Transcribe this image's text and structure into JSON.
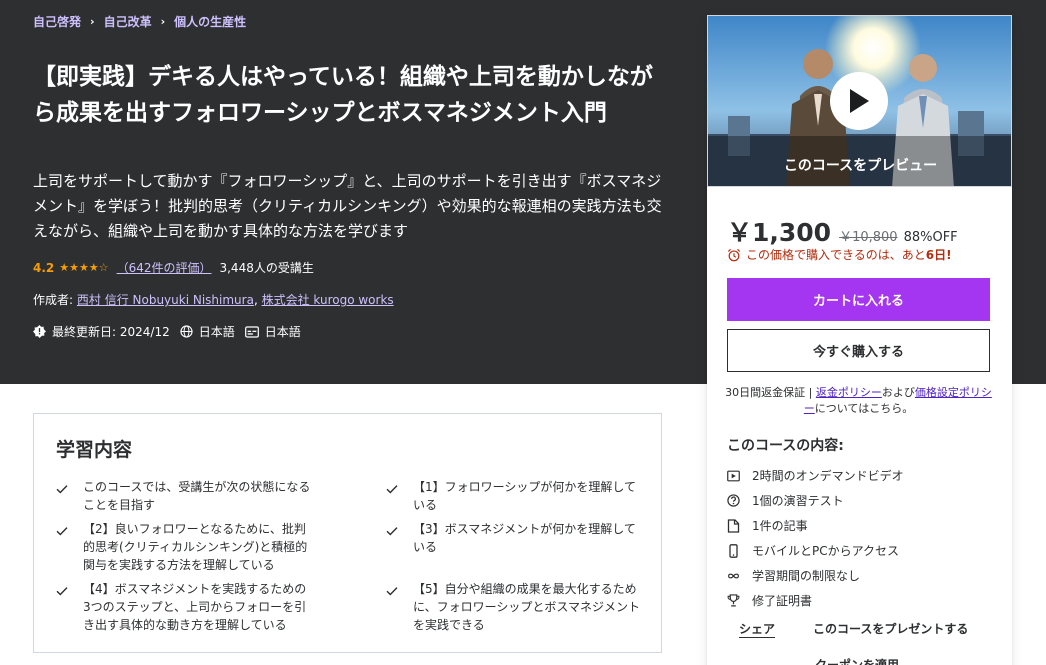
{
  "breadcrumb": [
    "自己啓発",
    "自己改革",
    "個人の生産性"
  ],
  "course": {
    "title": "【即実践】デキる人はやっている！組織や上司を動かしながら成果を出すフォロワーシップとボスマネジメント入門",
    "subtitle": "上司をサポートして動かす『フォロワーシップ』と、上司のサポートを引き出す『ボスマネジメント』を学ぼう！批判的思考（クリティカルシンキング）や効果的な報連相の実践方法も交えながら、組織や上司を動かす具体的な方法を学びます",
    "rating": "4.2",
    "rating_count": "（642件の評価）",
    "students": "3,448人の受講生",
    "authors_label": "作成者:",
    "author1": "西村 信行 Nobuyuki Nishimura",
    "author2": "株式会社 kurogo works",
    "updated": "最終更新日: 2024/12",
    "language": "日本語",
    "captions": "日本語"
  },
  "card": {
    "preview_label": "このコースをプレビュー",
    "price": "￥1,300",
    "original_price": "￥10,800",
    "discount": "88%OFF",
    "urgency_text": "この価格で購入できるのは、あと",
    "urgency_days": "6日!",
    "cart_button": "カートに入れる",
    "buy_button": "今すぐ購入する",
    "guarantee_prefix": "30日間返金保証 |",
    "refund_link": "返金ポリシー",
    "and_text": "および",
    "pricing_link": "価格設定ポリシー",
    "suffix": "についてはこちら。",
    "includes_title": "このコースの内容:",
    "includes": [
      {
        "icon": "video-icon",
        "label": "2時間のオンデマンドビデオ"
      },
      {
        "icon": "quiz-icon",
        "label": "1個の演習テスト"
      },
      {
        "icon": "file-icon",
        "label": "1件の記事"
      },
      {
        "icon": "mobile-icon",
        "label": "モバイルとPCからアクセス"
      },
      {
        "icon": "infinity-icon",
        "label": "学習期間の制限なし"
      },
      {
        "icon": "trophy-icon",
        "label": "修了証明書"
      }
    ],
    "share": "シェア",
    "gift": "このコースをプレゼントする",
    "coupon": "クーポンを適用"
  },
  "learn": {
    "title": "学習内容",
    "items": [
      "このコースでは、受講生が次の状態になることを目指す",
      "【1】フォロワーシップが何かを理解している",
      "【2】良いフォロワーとなるために、批判的思考(クリティカルシンキング)と積極的関与を実践する方法を理解している",
      "【3】ボスマネジメントが何かを理解している",
      "【4】ボスマネジメントを実践するための3つのステップと、上司からフォローを引き出す具体的な動き方を理解している",
      "【5】自分や組織の成果を最大化するために、フォロワーシップとボスマネジメントを実践できる"
    ]
  },
  "colors": {
    "hero_bg": "#2d2f31",
    "link": "#cec0fc",
    "accent": "#a435f0",
    "star": "#f69c08",
    "urgency": "#b32d0f"
  }
}
